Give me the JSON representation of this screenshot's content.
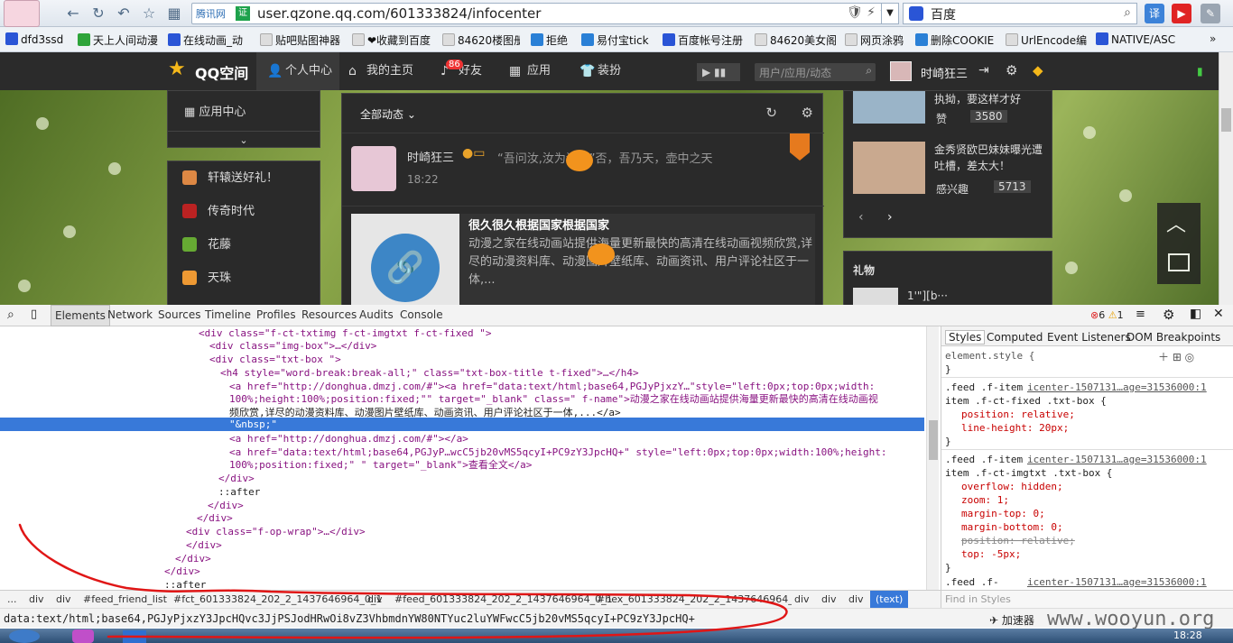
{
  "browser": {
    "url_site": "腾讯网",
    "url_badge": "证",
    "url": "user.qzone.qq.com/601333824/infocenter",
    "search_engine": "百度",
    "bookmarks": [
      "dfd3ssd",
      "天上人间动漫",
      "在线动画_动",
      "贴吧贴图神器",
      "❤收藏到百度",
      "84620楼图册",
      "拒绝",
      "易付宝tick",
      "百度帐号注册",
      "84620美女阁",
      "网页涂鸦",
      "删除COOKIE",
      "UrlEncode编",
      "NATIVE/ASC"
    ]
  },
  "qzone": {
    "logo": "QQ空间",
    "nav": [
      "个人中心",
      "我的主页",
      "好友",
      "应用",
      "装扮"
    ],
    "friend_badge": "86",
    "search_placeholder": "用户/应用/动态",
    "username": "时崎狂三",
    "app_center": "应用中心",
    "side_apps": [
      "轩辕送好礼！",
      "传奇时代",
      "花藤",
      "天珠"
    ],
    "feed_filter": "全部动态",
    "feed_name": "时崎狂三",
    "feed_quote": "“吾问汝,汝为谁?\"”否，吾乃天，壶中之天",
    "feed_time": "18:22",
    "card_title": "很久很久根据国家根据国家",
    "card_desc": "动漫之家在线动画站提供海量更新最快的高清在线动画视频欣赏,详尽的动漫资料库、动漫图片壁纸库、动画资讯、用户评论社区于一体,...",
    "right_items": [
      {
        "text": "执拗，要这样才好",
        "action": "赞",
        "count": "3580"
      },
      {
        "text": "金秀贤欧巴妹妹曝光遭吐槽，差太大！",
        "action": "感兴趣",
        "count": "5713"
      }
    ],
    "gift_title": "礼物",
    "gift_text": "1'\"][b···"
  },
  "devtools": {
    "tabs": [
      "Elements",
      "Network",
      "Sources",
      "Timeline",
      "Profiles",
      "Resources",
      "Audits",
      "Console"
    ],
    "errors": "6",
    "warnings": "1",
    "lines": [
      "<div class=\"f-ct-txtimg f-ct-imgtxt f-ct-fixed \">",
      "<div class=\"img-box\">…</div>",
      "<div class=\"txt-box \">",
      "<h4 style=\"word-break:break-all;\" class=\"txt-box-title t-fixed\">…</h4>",
      "<a href=\"http://donghua.dmzj.com/#\"><a href=\"data:text/html;base64,PGJyPjxzY…\"style=\"left:0px;top:0px;width:",
      "100%;height:100%;position:fixed;\"\" target=\"_blank\" class=\" f-name\">动漫之家在线动画站提供海量更新最快的高清在线动画视",
      "频欣赏,详尽的动漫资料库、动漫图片壁纸库、动画资讯、用户评论社区于一体,...</a>",
      "\"&nbsp;\"",
      "<a href=\"http://donghua.dmzj.com/#\"></a>",
      "<a href=\"data:text/html;base64,PGJyP…wcC5jb20vMS5qcyI+PC9zY3JpcHQ+\" style=\"left:0px;top:0px;width:100%;height:",
      "100%;position:fixed;\" \" target=\"_blank\">查看全文</a>",
      "</div>",
      "::after",
      "</div>",
      "</div>",
      "<div class=\"f-op-wrap\">…</div>",
      "</div>",
      "</div>",
      "</div>",
      "::after"
    ],
    "style_tabs": [
      "Styles",
      "Computed",
      "Event Listeners",
      "DOM Breakpoints"
    ],
    "element_style": "element.style {",
    "rules": [
      {
        "selector": ".feed .f-item .f-ct-fixed .txt-box {",
        "source": "icenter-1507131…age=31536000:1",
        "props": [
          "position: relative;",
          "line-height: 20px;"
        ]
      },
      {
        "selector": ".feed .f-item .f-ct-imgtxt .txt-box {",
        "source": "icenter-1507131…age=31536000:1",
        "props": [
          "overflow: hidden;",
          "zoom: 1;",
          "margin-top: 0;",
          "margin-bottom: 0;",
          "position: relative;",
          "top: -5px;"
        ]
      },
      {
        "selector": ".feed .f-",
        "source": "icenter-1507131…age=31536000:1",
        "props": []
      }
    ],
    "find_placeholder": "Find in Styles",
    "breadcrumbs": [
      "...",
      "div",
      "div",
      "#feed_friend_list",
      "#fct_601333824_202_2_1437646964_0_1",
      "div",
      "#feed_601333824_202_2_1437646964_0_1",
      "#hex_601333824_202_2_1437646964_0_1",
      "div",
      "div",
      "div",
      "(text)"
    ],
    "status": "data:text/html;base64,PGJyPjxzY3JpcHQvc3JjPSJodHRwOi8vZ3VhbmdnYW80NTYuc2luYWFwcC5jb20vMS5qcyI+PC9zY3JpcHQ+",
    "accelerator": "加速器",
    "watermark": "www.wooyun.org",
    "clock": "18:28"
  }
}
